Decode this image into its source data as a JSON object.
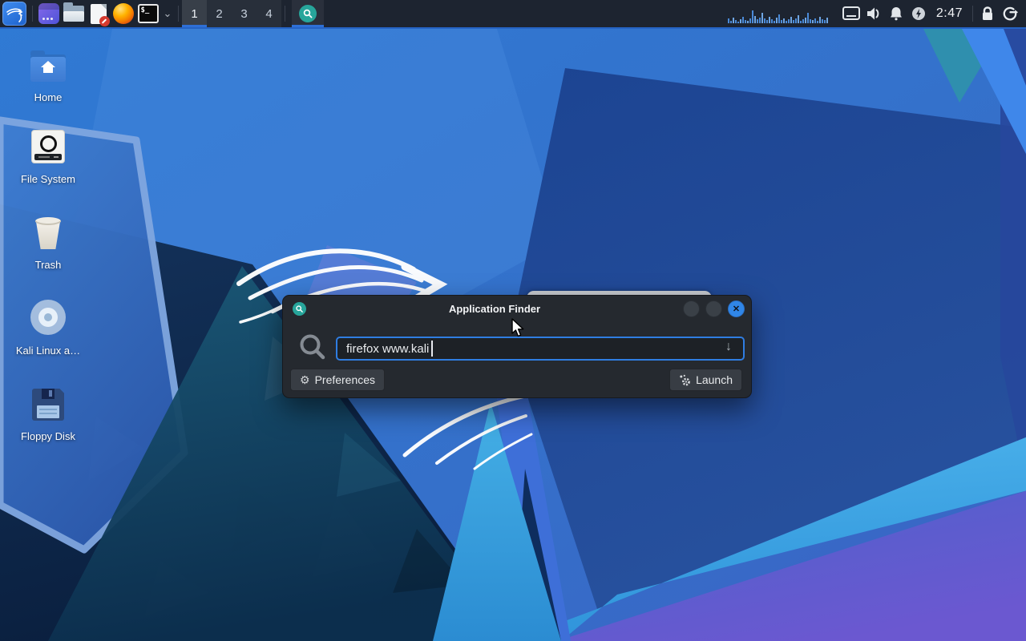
{
  "panel": {
    "workspaces": {
      "items": [
        "1",
        "2",
        "3",
        "4"
      ],
      "active": "1"
    },
    "clock": "2:47",
    "terminal_glyph": "$_",
    "spectrum_bars": [
      6,
      3,
      7,
      4,
      2,
      5,
      8,
      4,
      3,
      6,
      16,
      9,
      5,
      7,
      13,
      6,
      4,
      8,
      5,
      3,
      7,
      11,
      4,
      6,
      3,
      5,
      8,
      4,
      6,
      10,
      3,
      5,
      7,
      13,
      5,
      4,
      6,
      3,
      8,
      5,
      4,
      7
    ]
  },
  "desktop": {
    "icons": [
      {
        "label": "Home"
      },
      {
        "label": "File System"
      },
      {
        "label": "Trash"
      },
      {
        "label": "Kali Linux a…"
      },
      {
        "label": "Floppy Disk"
      }
    ]
  },
  "window": {
    "title": "Application Finder",
    "search": {
      "value": "firefox www.kali"
    },
    "preferences_label": "Preferences",
    "launch_label": "Launch"
  },
  "icons": {
    "dropdown_arrow": "↓",
    "chevron_down": "⌄",
    "gear": "⚙",
    "close_x": "✕"
  },
  "colors": {
    "accent": "#2e6fd6",
    "close_button": "#3086e8",
    "appfinder_teal": "#27a59b",
    "panel_bg": "#1d2430"
  }
}
